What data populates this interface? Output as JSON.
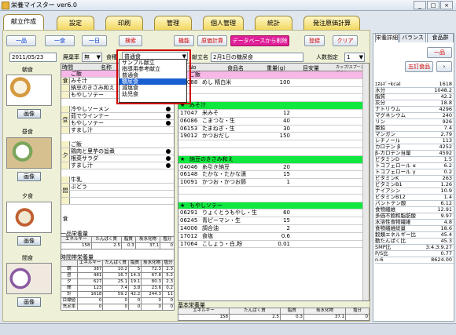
{
  "window": {
    "title": "栄養マイスター ver6.0"
  },
  "tabs": [
    "献立作成",
    "設定",
    "印刷",
    "管理",
    "個人管理",
    "統計",
    "発注原価計算"
  ],
  "toolbar": {
    "one_item": "一品",
    "one_meal": "一食",
    "one_day": "一日",
    "search": "検索",
    "function": "機能",
    "cost": "原価計算",
    "delete_db": "データベースから削除",
    "register": "登録",
    "clear": "クリア"
  },
  "controls": {
    "date": "2011/05/23",
    "waste_label": "廃棄率",
    "waste_value": "無",
    "dish_label": "食種",
    "dish_value": "普通食",
    "menu_name_label": "献立名",
    "menu_name_value": "2月1日の糖尿食",
    "people_label": "人数指定",
    "people_value": "1"
  },
  "dropdown": {
    "options": [
      "サンプル献立",
      "指導用参考献立",
      "普通食",
      "糖尿食",
      "減塩食",
      "幼児食"
    ],
    "selected": 3
  },
  "meals": [
    {
      "label": "朝食",
      "button": "画像"
    },
    {
      "label": "昼食",
      "button": "画像"
    },
    {
      "label": "夕食",
      "button": "画像"
    },
    {
      "label": "間食",
      "button": "画像"
    }
  ],
  "menu": {
    "header": [
      "時間",
      "名称"
    ],
    "groups": [
      {
        "name": "朝食",
        "items": [
          "ご飯",
          "みそ汁",
          "納豆のきさみ和え",
          "もやしソテー"
        ]
      },
      {
        "name": "昼食",
        "items": [
          "冷やしソーメン",
          "茹でウインナー",
          "もやしソテー",
          "すまし汁"
        ]
      },
      {
        "name": "夕食",
        "items": [
          "ご飯",
          "鶏肉と里芋の旨煮",
          "根菜サラダ",
          "すまし汁"
        ]
      },
      {
        "name": "間食",
        "items": [
          "牛乳",
          "ぶどう"
        ]
      }
    ]
  },
  "one_dish_nutrition": {
    "title": "一品栄養量",
    "headers": [
      "エネルギー",
      "たんぱく質",
      "脂質",
      "炭水化物",
      "塩分"
    ],
    "row": [
      "158",
      "2.5",
      "0.3",
      "37.1",
      "0"
    ]
  },
  "time_nutrition": {
    "title": "時間帯栄養量",
    "headers": [
      "",
      "エネルギー",
      "たんぱく質",
      "脂質",
      "炭水化物",
      "塩分"
    ],
    "rows": [
      [
        "朝",
        "387",
        "10.2",
        "5",
        "72.3",
        "2.3"
      ],
      [
        "昼",
        "481",
        "16.7",
        "14.3",
        "67.8",
        "5.2"
      ],
      [
        "夕",
        "627",
        "25.1",
        "19.1",
        "80.3",
        "2.3"
      ],
      [
        "間",
        "123",
        "7.4",
        "3.8",
        "23.6",
        "0.2"
      ],
      [
        "計",
        "1618",
        "59.2",
        "42.2",
        "244.3",
        "11"
      ],
      [
        "目標値",
        "0",
        "0",
        "0",
        "0",
        "0"
      ],
      [
        "充足率",
        "0",
        "0",
        "0",
        "0",
        "0"
      ]
    ]
  },
  "food_table": {
    "headers": [
      "",
      "No",
      "食品名",
      "重量(g)",
      "目安量",
      "カップ/スプーン/グラム"
    ],
    "rows": [
      {
        "type": "pink",
        "name": "ご飯"
      },
      {
        "type": "item",
        "no": "01088",
        "name": "めし 精白米",
        "weight": "100"
      },
      {
        "type": "blank"
      },
      {
        "type": "blank"
      },
      {
        "type": "green",
        "name": "みそ汁"
      },
      {
        "type": "item",
        "no": "17047",
        "name": "米みそ",
        "weight": "12"
      },
      {
        "type": "item",
        "no": "06086",
        "name": "こまつな・生",
        "weight": "40"
      },
      {
        "type": "item",
        "no": "06153",
        "name": "たまねぎ・生",
        "weight": "30"
      },
      {
        "type": "item",
        "no": "19012",
        "name": "かつおだし",
        "weight": "150"
      },
      {
        "type": "blank"
      },
      {
        "type": "blank"
      },
      {
        "type": "green",
        "name": "納豆のきさみ和え"
      },
      {
        "type": "item",
        "no": "04046",
        "name": "糸引き納豆",
        "weight": "20"
      },
      {
        "type": "item",
        "no": "06148",
        "name": "たかな・たかな漬",
        "weight": "15"
      },
      {
        "type": "item",
        "no": "10091",
        "name": "かつお・かつお節",
        "weight": "1"
      },
      {
        "type": "blank"
      },
      {
        "type": "blank"
      },
      {
        "type": "green",
        "name": "もやしソテー"
      },
      {
        "type": "item",
        "no": "06291",
        "name": "りょくとうもやし・生",
        "weight": "60"
      },
      {
        "type": "item",
        "no": "06245",
        "name": "青ピーマン・生",
        "weight": "15"
      },
      {
        "type": "item",
        "no": "14006",
        "name": "調合油",
        "weight": "2"
      },
      {
        "type": "item",
        "no": "17012",
        "name": "食塩",
        "weight": "0.6"
      },
      {
        "type": "item",
        "no": "17064",
        "name": "こしょう・白,粉",
        "weight": "0.01"
      }
    ]
  },
  "basic_nutrition": {
    "title": "基本栄養量",
    "headers": [
      "エネルギー",
      "たんぱく質",
      "脂質",
      "炭水化物",
      "塩分"
    ],
    "row": [
      "158",
      "2.5",
      "0.3",
      "37.1",
      "0"
    ]
  },
  "right_panel": {
    "tabs": [
      "栄養詳細",
      "バランス",
      "食品群"
    ],
    "one_item": "一品",
    "five_food": "五訂食品",
    "fields": [
      [
        "ｴﾈﾙｷﾞｰkcal",
        "1618"
      ],
      [
        "水分",
        "1048.2"
      ],
      [
        "脂質",
        "42.2"
      ],
      [
        "灰分",
        "18.8"
      ],
      [
        "ナトリウム",
        "4296"
      ],
      [
        "マグネシウム",
        "240"
      ],
      [
        "リン",
        "926"
      ],
      [
        "亜鉛",
        "7.4"
      ],
      [
        "マンガン",
        "2.79"
      ],
      [
        "レチノール",
        "113"
      ],
      [
        "カロテン β",
        "4252"
      ],
      [
        "β-カロテン当量",
        "4592"
      ],
      [
        "ビタミンD",
        "1.5"
      ],
      [
        "トコフェロール α",
        "6.2"
      ],
      [
        "トコフェロール γ",
        "0.2"
      ],
      [
        "ビタミンK",
        "263"
      ],
      [
        "ビタミンB1",
        "1.26"
      ],
      [
        "ナイアシン",
        "10.9"
      ],
      [
        "ビタミンB12",
        "1.4"
      ],
      [
        "パントテン酸",
        "6.12"
      ],
      [
        "食物繊維",
        "12.91"
      ],
      [
        "多価不飽和脂肪酸",
        "9.97"
      ],
      [
        "水溶性食物繊維",
        "4.8"
      ],
      [
        "食物繊維総量",
        "18.6"
      ],
      [
        "穀類エネルギー比",
        "45.4"
      ],
      [
        "動たんぱく比",
        "45.3"
      ],
      [
        "SMP比",
        "3:4.3:9.27"
      ],
      [
        "P/S比",
        "0.77"
      ],
      [
        "n-6",
        "8624.00"
      ]
    ]
  }
}
